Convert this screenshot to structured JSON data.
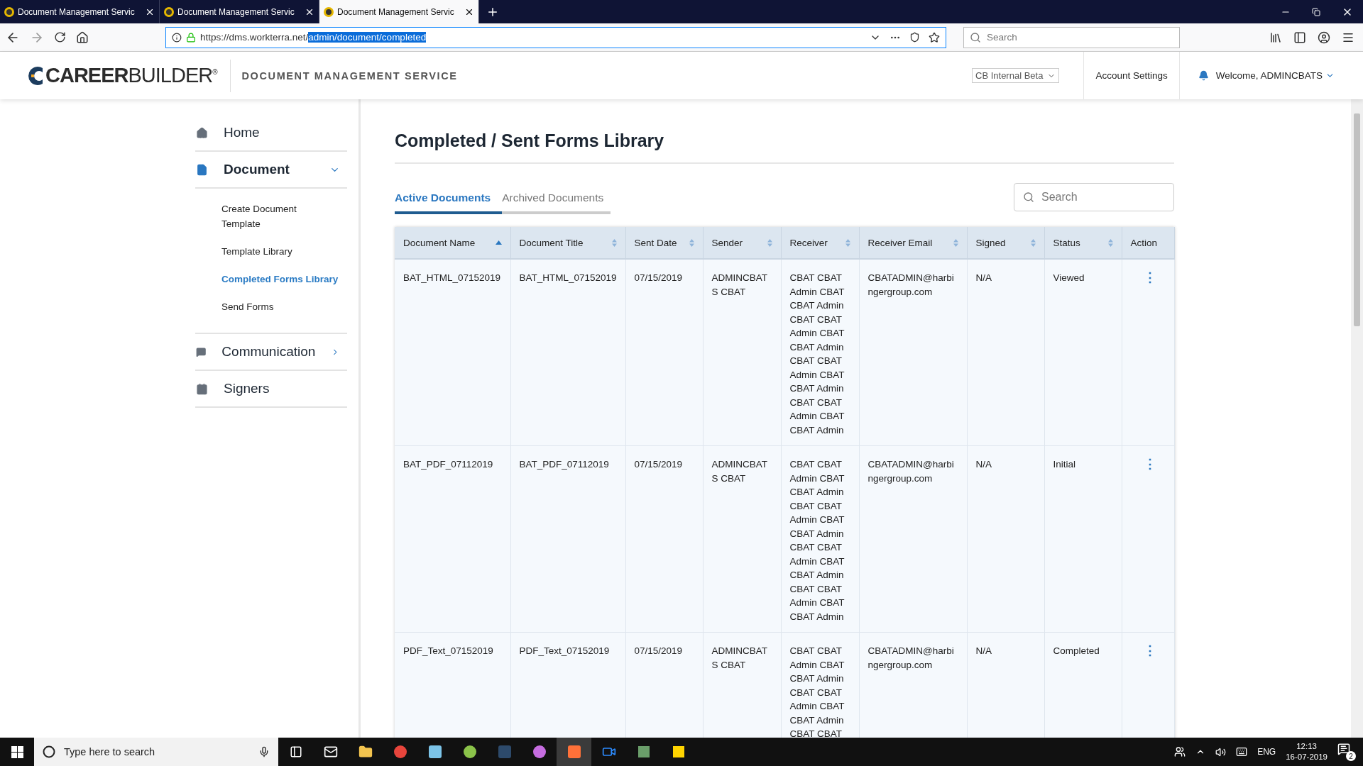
{
  "browser": {
    "tabs": [
      {
        "title": "Document Management Servic",
        "selected": false
      },
      {
        "title": "Document Management Servic",
        "selected": false
      },
      {
        "title": "Document Management Servic",
        "selected": true
      }
    ],
    "url": {
      "plain": "https://dms.workterra.net/",
      "highlighted": "admin/document/completed"
    },
    "search": {
      "placeholder": "Search"
    }
  },
  "header": {
    "logo": "**CAREER**BUILDER$^{®}$",
    "service": "DOCUMENT MANAGEMENT SERVICE",
    "environment": "CB Internal Beta",
    "account": "Account Settings",
    "welcome": "Welcome, ADMINCBATS"
  },
  "sidebar": {
    "items": [
      {
        "label": "Home",
        "kind": "link"
      },
      {
        "label": "Document",
        "kind": "group",
        "expanded": true,
        "children": [
          {
            "label": "Create Document Template",
            "selected": false
          },
          {
            "label": "Template Library",
            "selected": false
          },
          {
            "label": "Completed Forms Library",
            "selected": true
          },
          {
            "label": "Send Forms",
            "selected": false
          }
        ]
      },
      {
        "label": "Communication",
        "kind": "group",
        "expanded": false
      },
      {
        "label": "Signers",
        "kind": "link"
      }
    ]
  },
  "page": {
    "title": "Completed / Sent Forms Library",
    "tabs": [
      {
        "label": "Active Documents",
        "selected": true
      },
      {
        "label": "Archived Documents",
        "selected": false
      }
    ],
    "search": {
      "placeholder": "Search"
    },
    "table": {
      "columns": [
        {
          "label": "Document Name",
          "kind": "sortable",
          "sorted": true
        },
        {
          "label": "Document Title",
          "kind": "sortable",
          "sorted": false
        },
        {
          "label": "Sent Date",
          "kind": "sortable",
          "sorted": false
        },
        {
          "label": "Sender",
          "kind": "sortable",
          "sorted": false
        },
        {
          "label": "Receiver",
          "kind": "sortable",
          "sorted": false
        },
        {
          "label": "Receiver Email",
          "kind": "sortable",
          "sorted": false
        },
        {
          "label": "Signed",
          "kind": "sortable",
          "sorted": false
        },
        {
          "label": "Status",
          "kind": "sortable",
          "sorted": false
        },
        {
          "label": "Action",
          "kind": "plain"
        }
      ],
      "rows": [
        {
          "name": "BAT_HTML_07152019",
          "title": "BAT_HTML_07152019",
          "sent": "07/15/2019",
          "sender": "ADMINCBATS CBAT",
          "receiver": "CBAT CBAT Admin CBAT CBAT Admin CBAT CBAT Admin CBAT CBAT Admin CBAT CBAT Admin CBAT CBAT Admin CBAT CBAT Admin CBAT CBAT Admin",
          "email": "CBATADMIN@harbingergroup.com",
          "signed": "N/A",
          "status": "Viewed",
          "action": "⋮"
        },
        {
          "name": "BAT_PDF_07112019",
          "title": "BAT_PDF_07112019",
          "sent": "07/15/2019",
          "sender": "ADMINCBATS CBAT",
          "receiver": "CBAT CBAT Admin CBAT CBAT Admin CBAT CBAT Admin CBAT CBAT Admin CBAT CBAT Admin CBAT CBAT Admin CBAT CBAT Admin CBAT CBAT Admin",
          "email": "CBATADMIN@harbingergroup.com",
          "signed": "N/A",
          "status": "Initial",
          "action": "⋮"
        },
        {
          "name": "PDF_Text_07152019",
          "title": "PDF_Text_07152019",
          "sent": "07/15/2019",
          "sender": "ADMINCBATS CBAT",
          "receiver": "CBAT CBAT Admin CBAT CBAT Admin CBAT CBAT Admin CBAT CBAT Admin CBAT CBAT",
          "email": "CBATADMIN@harbingergroup.com",
          "signed": "N/A",
          "status": "Completed",
          "action": "⋮"
        }
      ]
    }
  },
  "taskbar": {
    "search": {
      "placeholder": "Type here to search"
    },
    "language": "ENG",
    "time": "12:13",
    "date": "16-07-2019",
    "notifications": "2"
  }
}
